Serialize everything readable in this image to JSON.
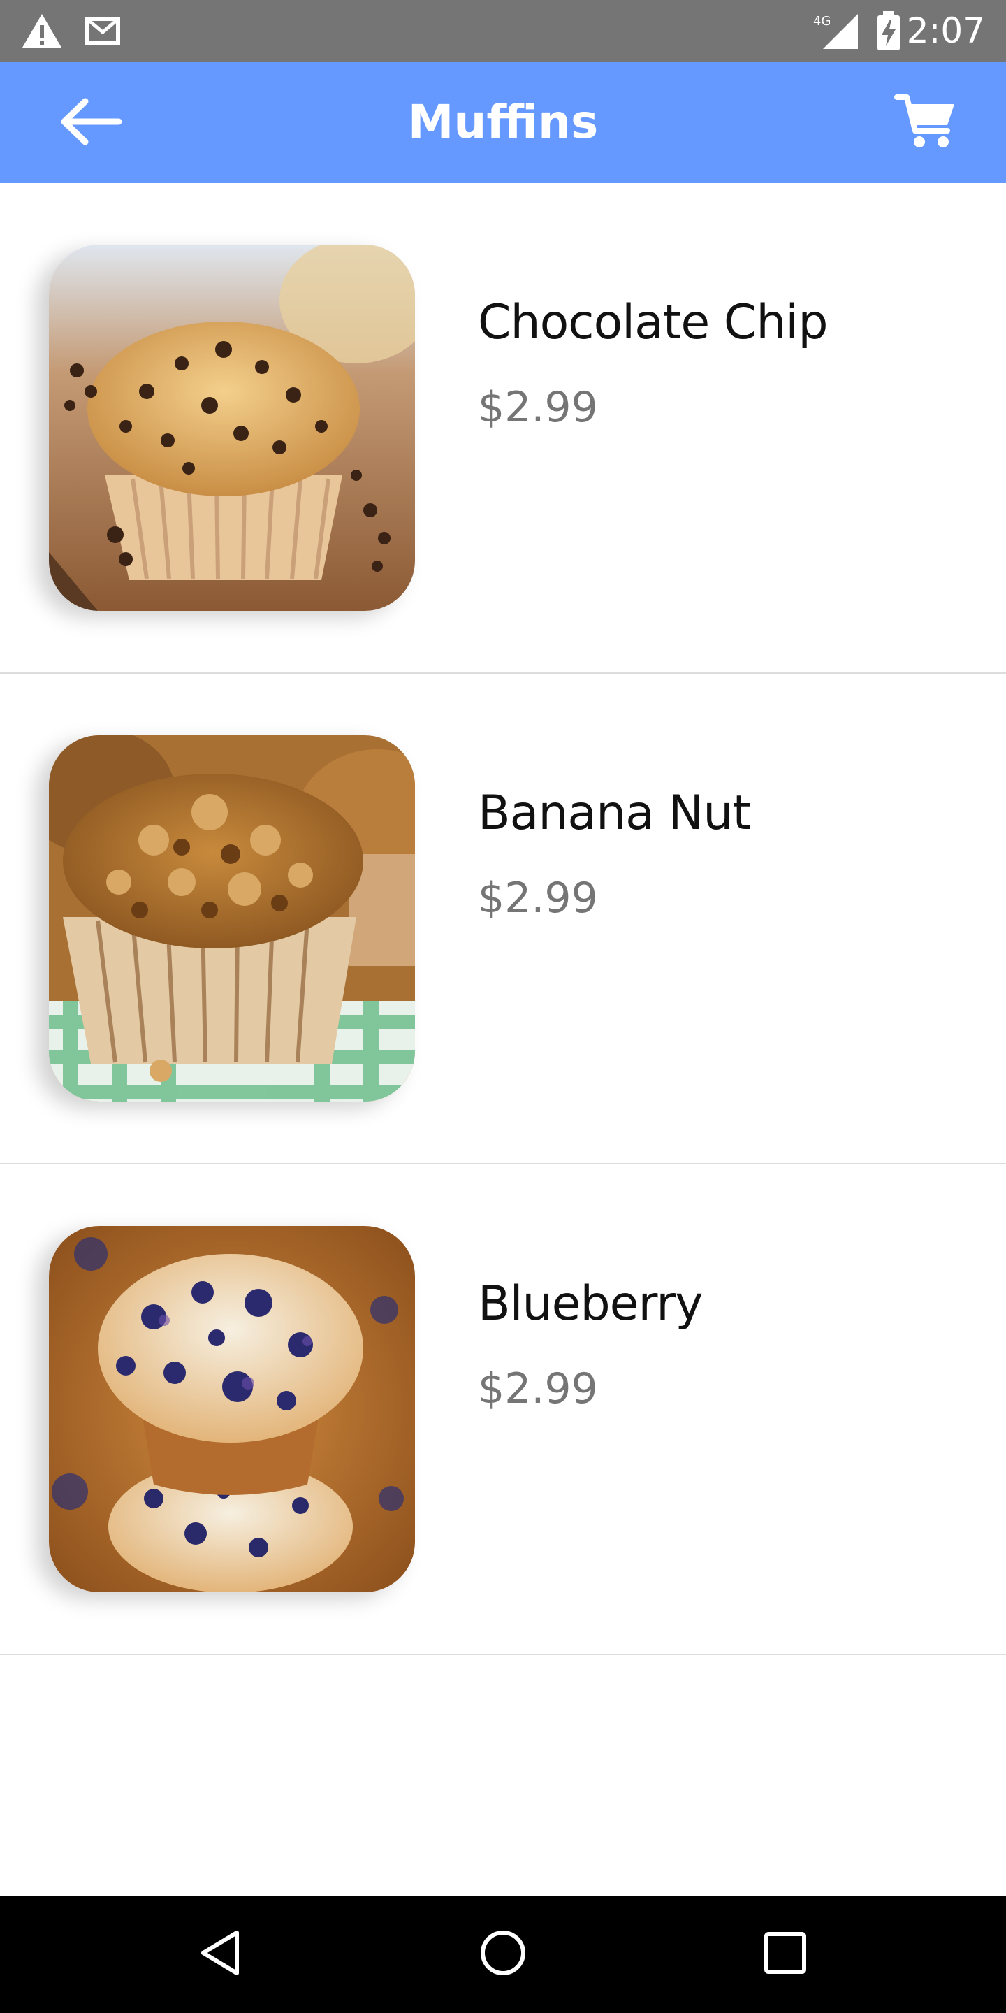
{
  "status_bar": {
    "time": "2:07",
    "network": "4G",
    "icons": [
      "warning-icon",
      "gmail-icon",
      "signal-icon",
      "battery-charging-icon"
    ]
  },
  "app_bar": {
    "title": "Muffins",
    "back_icon": "arrow-left-icon",
    "cart_icon": "cart-icon",
    "color": "#6699ff"
  },
  "products": [
    {
      "name": "Chocolate Chip",
      "price": "$2.99",
      "image": "chocolate-chip-muffin"
    },
    {
      "name": "Banana Nut",
      "price": "$2.99",
      "image": "banana-nut-muffin"
    },
    {
      "name": "Blueberry",
      "price": "$2.99",
      "image": "blueberry-muffin"
    }
  ],
  "nav_bar": {
    "buttons": [
      "back-triangle-icon",
      "home-circle-icon",
      "recents-square-icon"
    ]
  }
}
